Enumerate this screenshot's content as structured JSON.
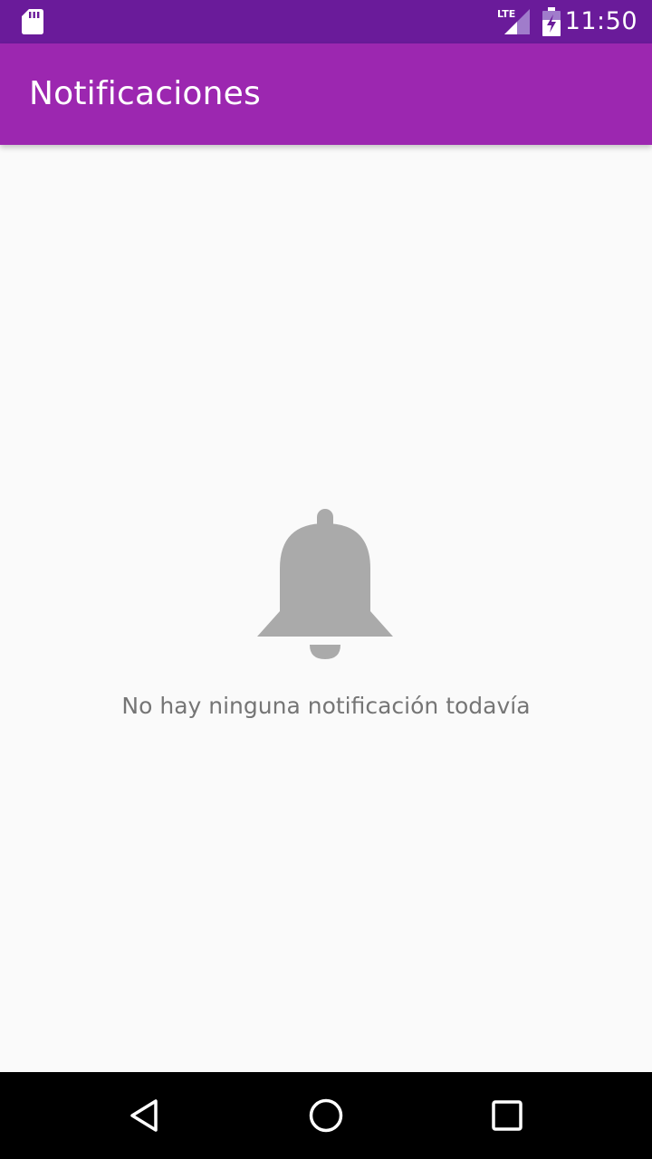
{
  "status_bar": {
    "time": "11:50",
    "network_label": "LTE",
    "icons": [
      "sd-card-icon",
      "lte-signal-icon",
      "battery-charging-icon"
    ]
  },
  "app_bar": {
    "title": "Notificaciones",
    "color": "#9c27b0",
    "status_color": "#6a1b9a"
  },
  "empty_state": {
    "icon": "bell-icon",
    "message": "No hay ninguna notificación todavía",
    "icon_color": "#aaaaaa",
    "text_color": "#757575"
  },
  "nav_bar": {
    "buttons": [
      "back-icon",
      "home-icon",
      "recents-icon"
    ]
  }
}
